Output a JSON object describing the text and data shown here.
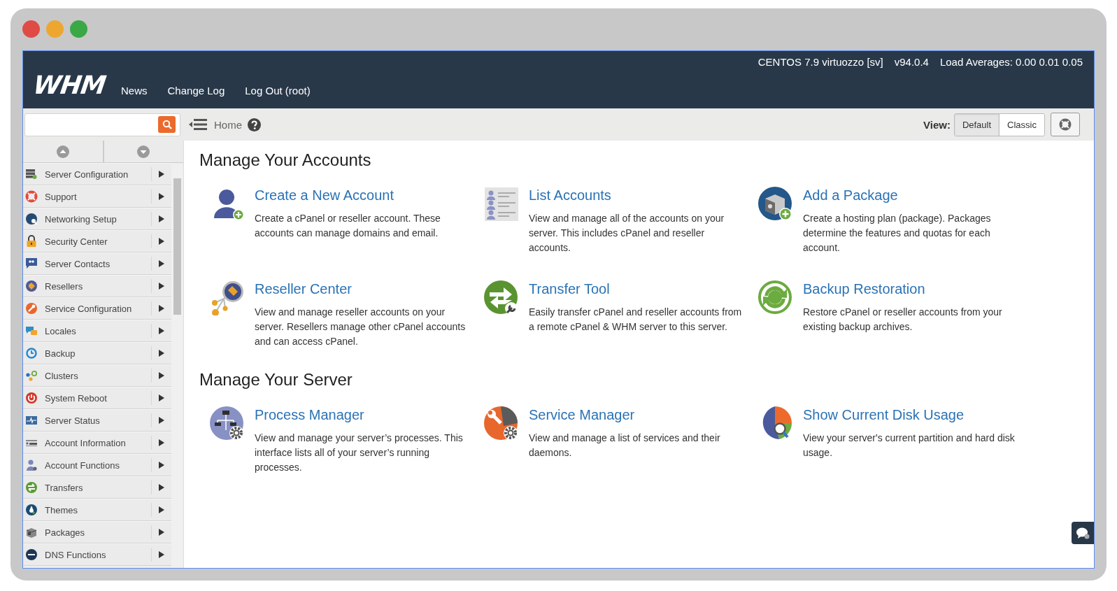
{
  "header": {
    "logo": "WHM",
    "nav": [
      "News",
      "Change Log",
      "Log Out (root)"
    ],
    "server_info": [
      "CENTOS 7.9 virtuozzo [sv]",
      "v94.0.4",
      "Load Averages: 0.00 0.01 0.05"
    ]
  },
  "toolbar": {
    "breadcrumb": "Home",
    "view_label": "View:",
    "view_options": [
      {
        "label": "Default",
        "selected": true
      },
      {
        "label": "Classic",
        "selected": false
      }
    ]
  },
  "sidebar": {
    "items": [
      {
        "label": "Server Configuration"
      },
      {
        "label": "Support"
      },
      {
        "label": "Networking Setup"
      },
      {
        "label": "Security Center"
      },
      {
        "label": "Server Contacts"
      },
      {
        "label": "Resellers"
      },
      {
        "label": "Service Configuration"
      },
      {
        "label": "Locales"
      },
      {
        "label": "Backup"
      },
      {
        "label": "Clusters"
      },
      {
        "label": "System Reboot"
      },
      {
        "label": "Server Status"
      },
      {
        "label": "Account Information"
      },
      {
        "label": "Account Functions"
      },
      {
        "label": "Transfers"
      },
      {
        "label": "Themes"
      },
      {
        "label": "Packages"
      },
      {
        "label": "DNS Functions"
      }
    ]
  },
  "sections": [
    {
      "title": "Manage Your Accounts",
      "cards": [
        {
          "title": "Create a New Account",
          "description": "Create a cPanel or reseller account. These accounts can manage domains and email."
        },
        {
          "title": "List Accounts",
          "description": "View and manage all of the accounts on your server. This includes cPanel and reseller accounts."
        },
        {
          "title": "Add a Package",
          "description": "Create a hosting plan (package). Packages determine the features and quotas for each account."
        },
        {
          "title": "Reseller Center",
          "description": "View and manage reseller accounts on your server. Resellers manage other cPanel accounts and can access cPanel."
        },
        {
          "title": "Transfer Tool",
          "description": "Easily transfer cPanel and reseller accounts from a remote cPanel & WHM server to this server."
        },
        {
          "title": "Backup Restoration",
          "description": "Restore cPanel or reseller accounts from your existing backup archives."
        }
      ]
    },
    {
      "title": "Manage Your Server",
      "cards": [
        {
          "title": "Process Manager",
          "description": "View and manage your server’s processes. This interface lists all of your server’s running processes."
        },
        {
          "title": "Service Manager",
          "description": "View and manage a list of services and their daemons."
        },
        {
          "title": "Show Current Disk Usage",
          "description": "View your server's current partition and hard disk usage."
        }
      ]
    }
  ]
}
